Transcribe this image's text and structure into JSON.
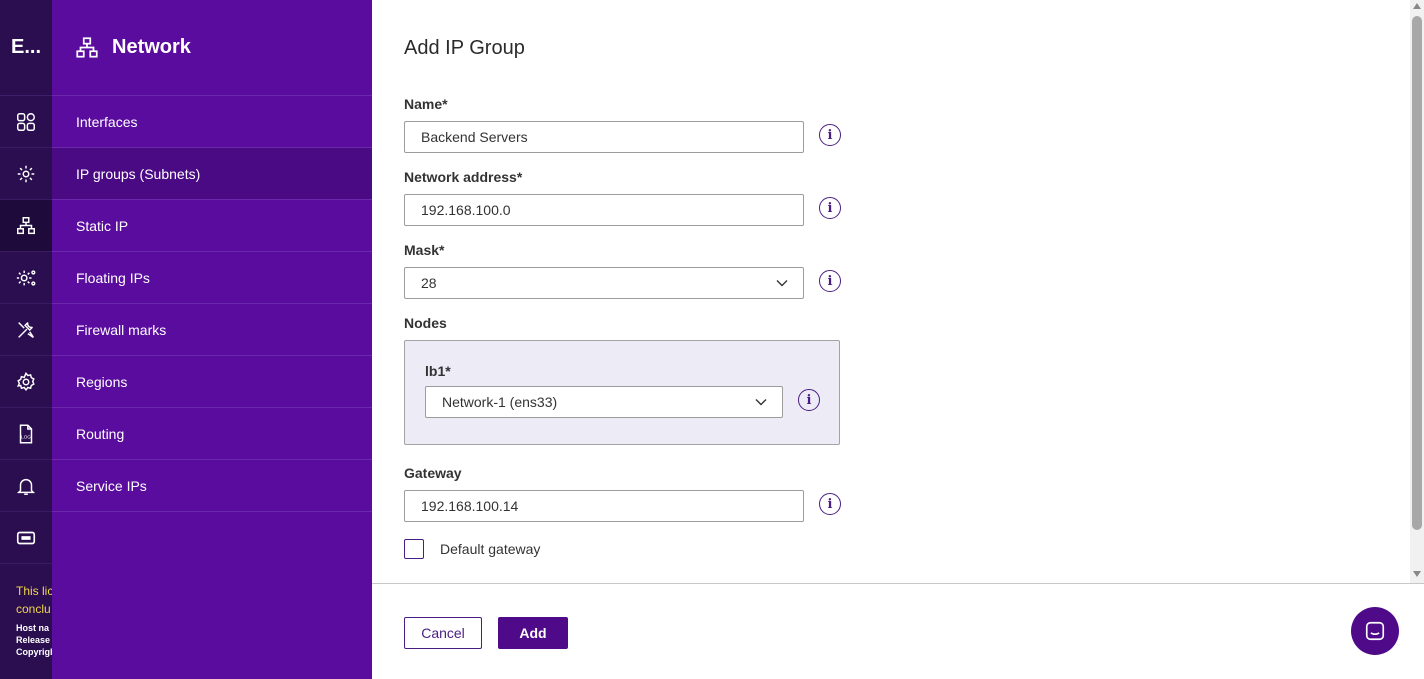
{
  "rail": {
    "brand": "E...",
    "items": [
      {
        "icon": "dashboard-icon"
      },
      {
        "icon": "network-settings-icon"
      },
      {
        "icon": "network-icon"
      },
      {
        "icon": "cluster-settings-icon"
      },
      {
        "icon": "tools-icon"
      },
      {
        "icon": "gear-icon"
      },
      {
        "icon": "log-file-icon"
      },
      {
        "icon": "bell-icon"
      },
      {
        "icon": "ticket-icon"
      }
    ],
    "license_line1": "This lic",
    "license_line2": "conclu",
    "host": "Host na",
    "release": "Release",
    "copyright": "Copyrigh"
  },
  "sidebar": {
    "title": "Network",
    "items": [
      {
        "label": "Interfaces"
      },
      {
        "label": "IP groups (Subnets)"
      },
      {
        "label": "Static IP"
      },
      {
        "label": "Floating IPs"
      },
      {
        "label": "Firewall marks"
      },
      {
        "label": "Regions"
      },
      {
        "label": "Routing"
      },
      {
        "label": "Service IPs"
      }
    ]
  },
  "form": {
    "title": "Add IP Group",
    "name_label": "Name*",
    "name_value": "Backend Servers",
    "network_label": "Network address*",
    "network_value": "192.168.100.0",
    "mask_label": "Mask*",
    "mask_value": "28",
    "nodes_label": "Nodes",
    "node_label": "lb1*",
    "node_value": "Network-1 (ens33)",
    "gateway_label": "Gateway",
    "gateway_value": "192.168.100.14",
    "default_gateway_label": "Default gateway",
    "default_gateway_checked": false,
    "info_glyph": "i"
  },
  "footer": {
    "cancel_label": "Cancel",
    "add_label": "Add"
  },
  "colors": {
    "rail_bg": "#2a0e4f",
    "panel_bg": "#5a0c9e",
    "accent": "#4f0a8a",
    "license_text": "#f2d64b",
    "nodes_bg": "#ecebf6"
  }
}
